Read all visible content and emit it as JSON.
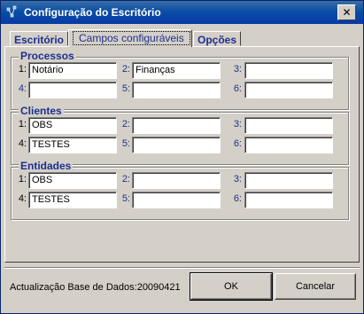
{
  "window": {
    "title": "Configuração do Escritório",
    "close_glyph": "✕"
  },
  "tabs": [
    {
      "label": "Escritório",
      "active": false
    },
    {
      "label": "Campos configuráveis",
      "active": true
    },
    {
      "label": "Opções",
      "active": false
    }
  ],
  "groups": [
    {
      "title": "Processos",
      "fields": [
        {
          "label": "1:",
          "value": "Notário"
        },
        {
          "label": "2:",
          "value": "Finanças"
        },
        {
          "label": "3:",
          "value": ""
        },
        {
          "label": "4:",
          "value": ""
        },
        {
          "label": "5:",
          "value": ""
        },
        {
          "label": "6:",
          "value": ""
        }
      ]
    },
    {
      "title": "Clientes",
      "fields": [
        {
          "label": "1:",
          "value": "OBS"
        },
        {
          "label": "2:",
          "value": ""
        },
        {
          "label": "3:",
          "value": ""
        },
        {
          "label": "4:",
          "value": "TESTES"
        },
        {
          "label": "5:",
          "value": ""
        },
        {
          "label": "6:",
          "value": ""
        }
      ]
    },
    {
      "title": "Entidades",
      "fields": [
        {
          "label": "1:",
          "value": "OBS"
        },
        {
          "label": "2:",
          "value": ""
        },
        {
          "label": "3:",
          "value": ""
        },
        {
          "label": "4:",
          "value": "TESTES"
        },
        {
          "label": "5:",
          "value": ""
        },
        {
          "label": "6:",
          "value": ""
        }
      ]
    }
  ],
  "footer": {
    "db_version": "Actualização Base de Dados:20090421",
    "ok_label": "OK",
    "cancel_label": "Cancelar"
  }
}
